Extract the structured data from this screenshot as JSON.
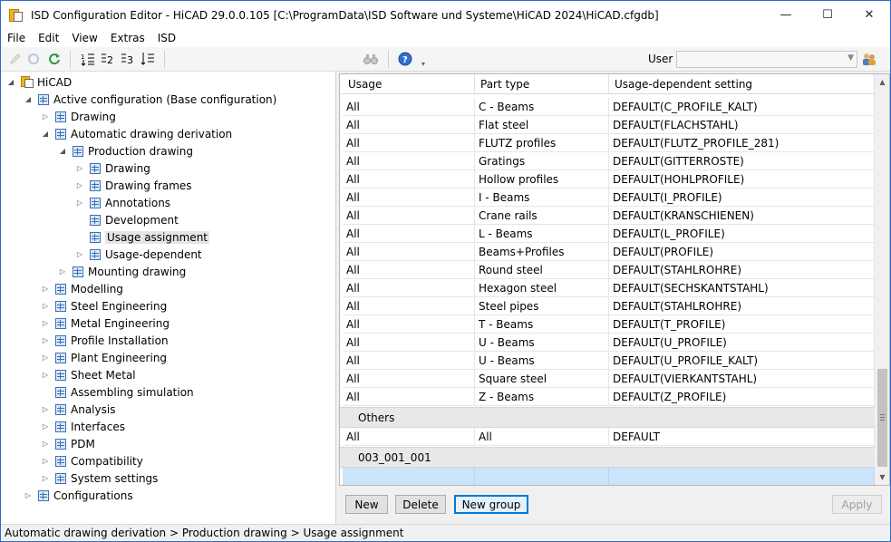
{
  "window": {
    "title": "ISD Configuration Editor  -  HiCAD 29.0.0.105 [C:\\ProgramData\\ISD Software und Systeme\\HiCAD 2024\\HiCAD.cfgdb]",
    "controls": {
      "minimize": "—",
      "maximize": "☐",
      "close": "✕"
    }
  },
  "menu": [
    "File",
    "Edit",
    "View",
    "Extras",
    "ISD"
  ],
  "toolbar": {
    "user_label": "User",
    "user_value": "",
    "icons": [
      "pencil-icon",
      "undo-icon",
      "refresh-icon",
      "sort-tree-icon",
      "level-2-icon",
      "level-3-icon",
      "sort-down-icon",
      "binoculars-icon",
      "help-icon",
      "users-icon"
    ]
  },
  "tree": [
    {
      "label": "HiCAD",
      "level": 0,
      "expander": "expanded",
      "root": true
    },
    {
      "label": "Active configuration (Base configuration)",
      "level": 1,
      "expander": "expanded"
    },
    {
      "label": "Drawing",
      "level": 2,
      "expander": "collapsed"
    },
    {
      "label": "Automatic drawing derivation",
      "level": 2,
      "expander": "expanded"
    },
    {
      "label": "Production drawing",
      "level": 3,
      "expander": "expanded"
    },
    {
      "label": "Drawing",
      "level": 4,
      "expander": "collapsed"
    },
    {
      "label": "Drawing frames",
      "level": 4,
      "expander": "collapsed"
    },
    {
      "label": "Annotations",
      "level": 4,
      "expander": "collapsed"
    },
    {
      "label": "Development",
      "level": 4,
      "expander": "none"
    },
    {
      "label": "Usage assignment",
      "level": 4,
      "expander": "none",
      "selected": true
    },
    {
      "label": "Usage-dependent",
      "level": 4,
      "expander": "collapsed"
    },
    {
      "label": "Mounting drawing",
      "level": 3,
      "expander": "collapsed"
    },
    {
      "label": "Modelling",
      "level": 2,
      "expander": "collapsed"
    },
    {
      "label": "Steel Engineering",
      "level": 2,
      "expander": "collapsed"
    },
    {
      "label": "Metal Engineering",
      "level": 2,
      "expander": "collapsed"
    },
    {
      "label": "Profile Installation",
      "level": 2,
      "expander": "collapsed"
    },
    {
      "label": "Plant Engineering",
      "level": 2,
      "expander": "collapsed"
    },
    {
      "label": "Sheet Metal",
      "level": 2,
      "expander": "collapsed"
    },
    {
      "label": "Assembling simulation",
      "level": 2,
      "expander": "none"
    },
    {
      "label": "Analysis",
      "level": 2,
      "expander": "collapsed"
    },
    {
      "label": "Interfaces",
      "level": 2,
      "expander": "collapsed"
    },
    {
      "label": "PDM",
      "level": 2,
      "expander": "collapsed"
    },
    {
      "label": "Compatibility",
      "level": 2,
      "expander": "collapsed"
    },
    {
      "label": "System settings",
      "level": 2,
      "expander": "collapsed"
    },
    {
      "label": "Configurations",
      "level": 1,
      "expander": "collapsed"
    }
  ],
  "grid": {
    "columns": [
      "Usage",
      "Part type",
      "Usage-dependent setting"
    ],
    "rows": [
      [
        "All",
        "C - Beams",
        "DEFAULT(C_PROFILE_KALT)"
      ],
      [
        "All",
        "Flat steel",
        "DEFAULT(FLACHSTAHL)"
      ],
      [
        "All",
        "FLUTZ profiles",
        "DEFAULT(FLUTZ_PROFILE_281)"
      ],
      [
        "All",
        "Gratings",
        "DEFAULT(GITTERROSTE)"
      ],
      [
        "All",
        "Hollow profiles",
        "DEFAULT(HOHLPROFILE)"
      ],
      [
        "All",
        "I - Beams",
        "DEFAULT(I_PROFILE)"
      ],
      [
        "All",
        "Crane rails",
        "DEFAULT(KRANSCHIENEN)"
      ],
      [
        "All",
        "L - Beams",
        "DEFAULT(L_PROFILE)"
      ],
      [
        "All",
        "Beams+Profiles",
        "DEFAULT(PROFILE)"
      ],
      [
        "All",
        "Round steel",
        "DEFAULT(STAHLROHRE)"
      ],
      [
        "All",
        "Hexagon steel",
        "DEFAULT(SECHSKANTSTAHL)"
      ],
      [
        "All",
        "Steel pipes",
        "DEFAULT(STAHLROHRE)"
      ],
      [
        "All",
        "T - Beams",
        "DEFAULT(T_PROFILE)"
      ],
      [
        "All",
        "U - Beams",
        "DEFAULT(U_PROFILE)"
      ],
      [
        "All",
        "U - Beams",
        "DEFAULT(U_PROFILE_KALT)"
      ],
      [
        "All",
        "Square steel",
        "DEFAULT(VIERKANTSTAHL)"
      ],
      [
        "All",
        "Z - Beams",
        "DEFAULT(Z_PROFILE)"
      ]
    ],
    "groups": [
      {
        "name": "Others",
        "rows": [
          [
            "All",
            "All",
            "DEFAULT"
          ]
        ]
      },
      {
        "name": "003_001_001",
        "rows": []
      }
    ],
    "new_row": [
      "",
      "",
      ""
    ]
  },
  "buttons": {
    "new": "New",
    "delete": "Delete",
    "new_group": "New group",
    "apply": "Apply"
  },
  "status": "Automatic drawing derivation > Production drawing > Usage assignment"
}
